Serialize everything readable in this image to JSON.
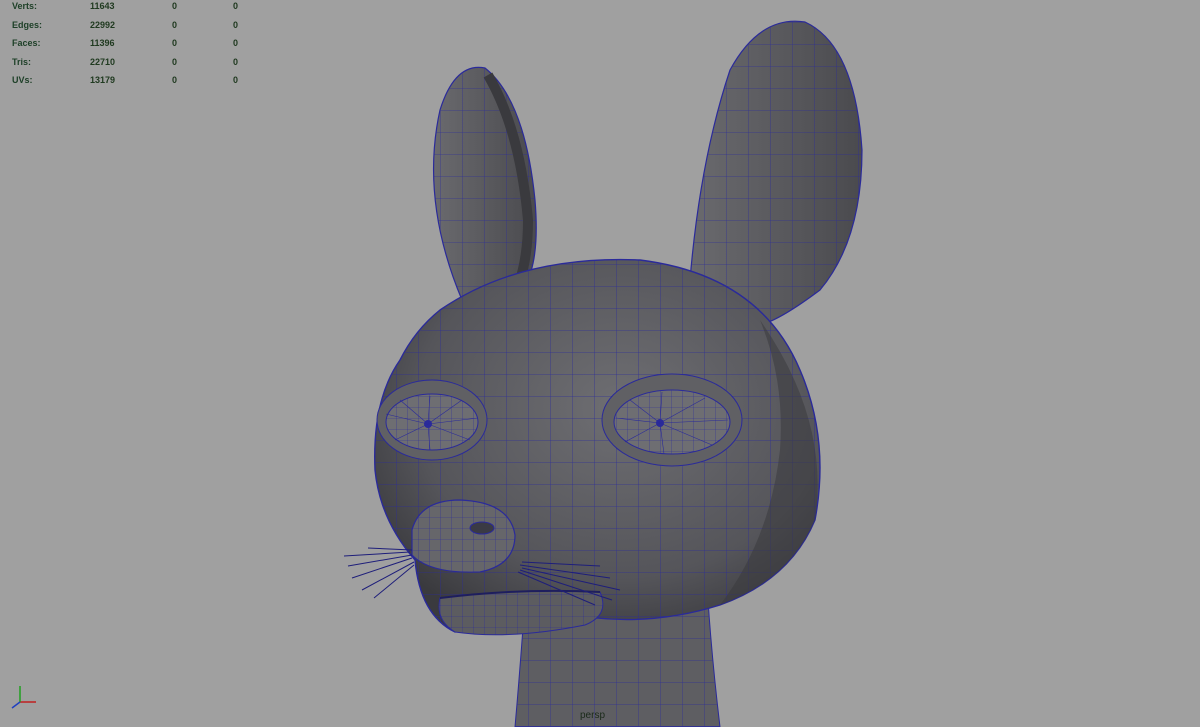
{
  "hud": {
    "rows": [
      {
        "label": "Verts:",
        "value": "11643",
        "selected": "0",
        "component": "0"
      },
      {
        "label": "Edges:",
        "value": "22992",
        "selected": "0",
        "component": "0"
      },
      {
        "label": "Faces:",
        "value": "11396",
        "selected": "0",
        "component": "0"
      },
      {
        "label": "Tris:",
        "value": "22710",
        "selected": "0",
        "component": "0"
      },
      {
        "label": "UVs:",
        "value": "13179",
        "selected": "0",
        "component": "0"
      }
    ]
  },
  "viewport": {
    "camera_label": "persp",
    "background_color": "#a0a0a0",
    "wireframe_color": "#2a2a9a",
    "mesh_color": "#5a5a5e"
  }
}
